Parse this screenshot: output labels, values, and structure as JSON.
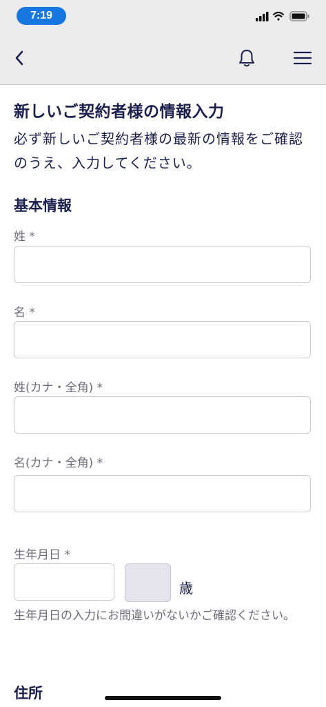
{
  "status_bar": {
    "time": "7:19",
    "icons": [
      "cellular-signal-icon",
      "wifi-icon",
      "battery-icon"
    ]
  },
  "nav": {
    "icons": [
      "back-chevron-icon",
      "bell-icon",
      "hamburger-menu-icon"
    ]
  },
  "page": {
    "title": "新しいご契約者様の情報入力",
    "description": "必ず新しいご契約者様の最新の情報をご確認のうえ、入力してください。"
  },
  "basic_info": {
    "section_title": "基本情報",
    "last_name_label": "姓 *",
    "first_name_label": "名 *",
    "last_name_kana_label": "姓(カナ・全角) *",
    "first_name_kana_label": "名(カナ・全角) *",
    "birthdate_label": "生年月日 *",
    "age_unit": "歳",
    "birthdate_note": "生年月日の入力にお間違いがないかご確認ください。"
  },
  "address": {
    "section_title": "住所"
  },
  "colors": {
    "accent": "#1677e0",
    "text": "#1a1f4d",
    "muted": "#6e6e7a",
    "nav_background": "#ececec",
    "disabled_field": "#e4e4ef"
  }
}
